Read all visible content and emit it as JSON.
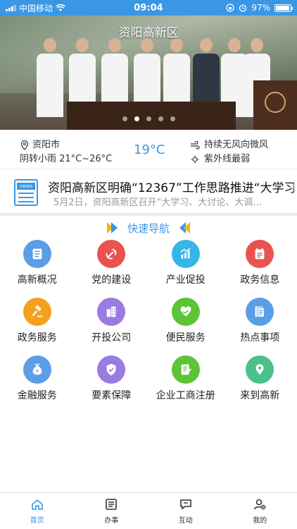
{
  "status_bar": {
    "carrier": "中国移动",
    "time": "09:04",
    "battery": "97%",
    "battery_level": 0.97
  },
  "banner": {
    "title": "资阳高新区",
    "slide_count": 5,
    "active_slide": 1
  },
  "weather": {
    "city": "资阳市",
    "condition": "阴转小雨 21°C~26°C",
    "current_temp": "19°C",
    "wind": "持续无风向微风",
    "uv": "紫外线最弱"
  },
  "news": {
    "icon_text": "news",
    "title": "资阳高新区明确“12367”工作思路推进“大学习",
    "summary": "5月2日，资阳高新区召开“大学习、大讨论、大调…"
  },
  "quick_nav": {
    "title": "快速导航",
    "items": [
      {
        "label": "高新概况",
        "icon": "list-icon",
        "color": "#5b9ee6"
      },
      {
        "label": "党的建设",
        "icon": "party-emblem-icon",
        "color": "#e8524f"
      },
      {
        "label": "产业促投",
        "icon": "bar-chart-icon",
        "color": "#36b6e8"
      },
      {
        "label": "政务信息",
        "icon": "calendar-icon",
        "color": "#e8524f"
      },
      {
        "label": "政务服务",
        "icon": "gavel-icon",
        "color": "#f5a11c"
      },
      {
        "label": "开投公司",
        "icon": "building-icon",
        "color": "#9a7be0"
      },
      {
        "label": "便民服务",
        "icon": "heart-hand-icon",
        "color": "#5cc436"
      },
      {
        "label": "热点事项",
        "icon": "document-icon",
        "color": "#5b9ee6"
      },
      {
        "label": "金融服务",
        "icon": "money-bag-icon",
        "color": "#5b9ee6"
      },
      {
        "label": "要素保障",
        "icon": "shield-check-icon",
        "color": "#9a7be0"
      },
      {
        "label": "企业工商注册",
        "icon": "form-icon",
        "color": "#5cc436"
      },
      {
        "label": "来到高新",
        "icon": "location-icon",
        "color": "#4cc08a"
      }
    ]
  },
  "tab_bar": {
    "tabs": [
      {
        "label": "首页",
        "icon": "home-icon",
        "active": true
      },
      {
        "label": "办事",
        "icon": "list-icon",
        "active": false
      },
      {
        "label": "互动",
        "icon": "chat-icon",
        "active": false
      },
      {
        "label": "我的",
        "icon": "user-icon",
        "active": false
      }
    ]
  },
  "colors": {
    "accent": "#3a97e6",
    "arrow_yellow": "#f5b41a"
  }
}
